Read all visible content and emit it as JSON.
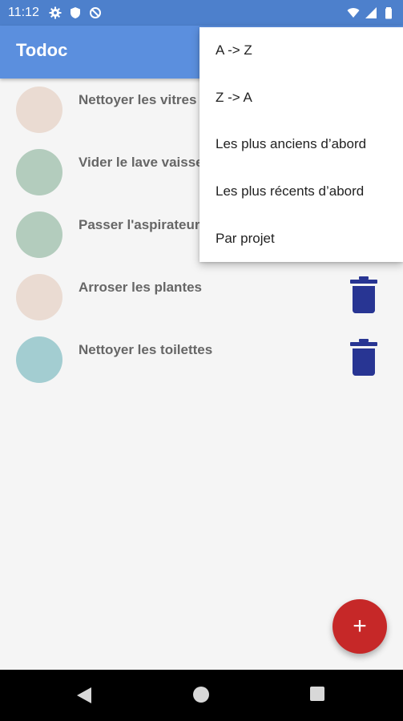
{
  "status_bar": {
    "time": "11:12",
    "icons_left": [
      "gear-icon",
      "shield-icon",
      "no-sync-icon"
    ],
    "icons_right": [
      "wifi-icon",
      "signal-icon",
      "battery-icon"
    ]
  },
  "app_bar": {
    "title": "Todoc",
    "color": "#5b8fde"
  },
  "tasks": [
    {
      "name": "Nettoyer les vitres",
      "color": "#eadbd2"
    },
    {
      "name": "Vider le lave vaisselle",
      "color": "#b3ccbd"
    },
    {
      "name": "Passer l'aspirateur",
      "color": "#b3ccbd"
    },
    {
      "name": "Arroser les plantes",
      "color": "#eadbd2"
    },
    {
      "name": "Nettoyer les toilettes",
      "color": "#a3cdd1"
    }
  ],
  "sort_menu": {
    "items": [
      "A -> Z",
      "Z -> A",
      "Les plus anciens d’abord",
      "Les plus récents d’abord",
      "Par projet"
    ]
  },
  "fab": {
    "label": "+",
    "color": "#c62828"
  },
  "nav_bar": {
    "icons": [
      "back-icon",
      "home-icon",
      "recents-icon"
    ]
  }
}
